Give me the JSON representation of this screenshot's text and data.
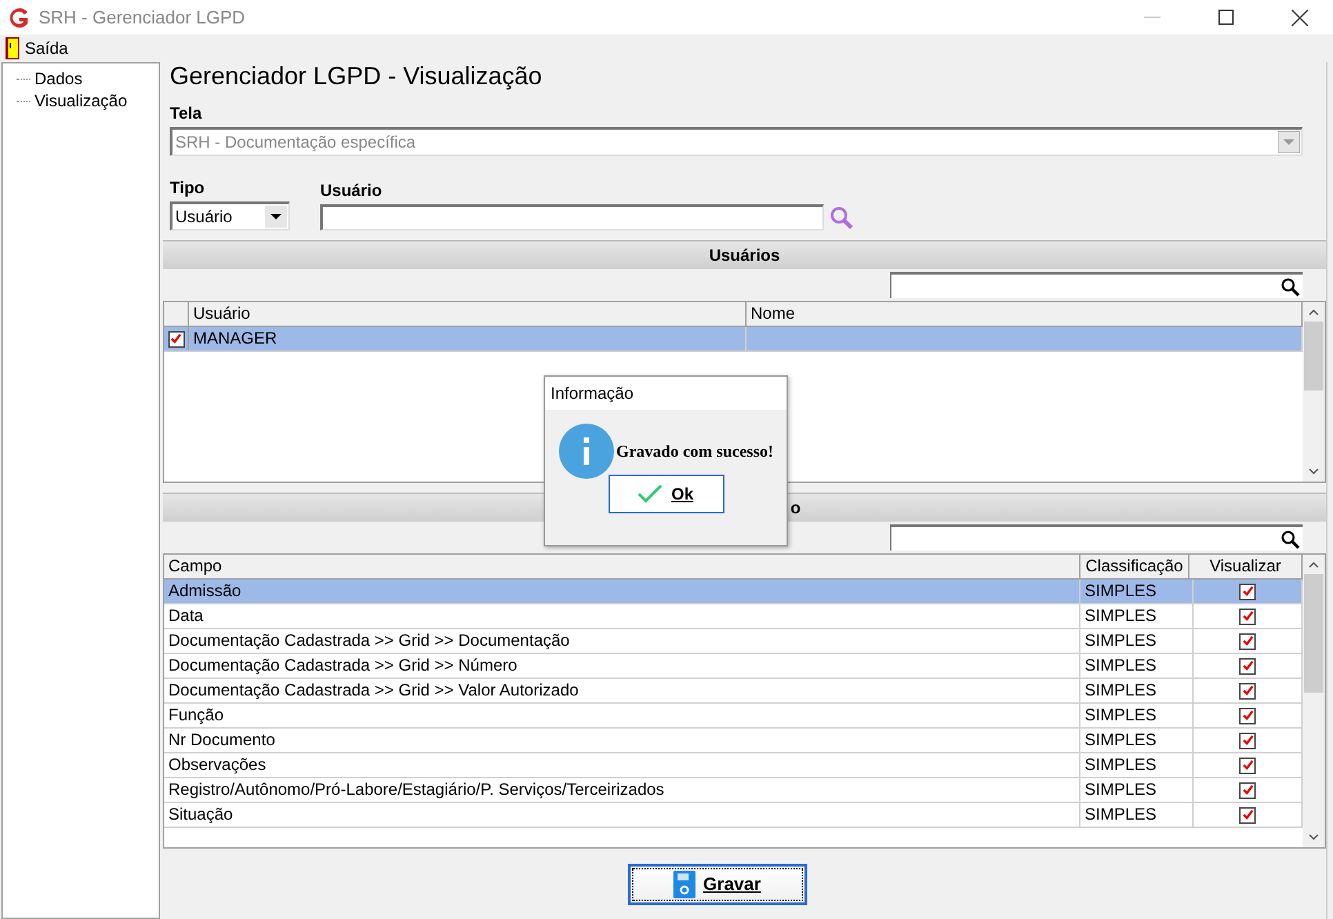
{
  "window": {
    "title": "SRH - Gerenciador LGPD"
  },
  "menu": [
    {
      "label": "Saída"
    }
  ],
  "sidebar": {
    "items": [
      {
        "label": "Dados"
      },
      {
        "label": "Visualização"
      }
    ]
  },
  "heading": "Gerenciador LGPD - Visualização",
  "tela": {
    "label": "Tela",
    "value": "SRH - Documentação específica",
    "disabled": true
  },
  "tipo": {
    "label": "Tipo",
    "value": "Usuário"
  },
  "usuario": {
    "label": "Usuário"
  },
  "users_section": {
    "title": "Usuários",
    "columns": [
      "Usuário",
      "Nome"
    ],
    "rows": [
      {
        "usuario": "MANAGER",
        "nome": "",
        "checked": true,
        "selected": true
      }
    ]
  },
  "fields_section": {
    "title": "o",
    "columns": [
      "Campo",
      "Classificação",
      "Visualizar"
    ],
    "rows": [
      {
        "campo": "Admissão",
        "classificacao": "SIMPLES",
        "checked": true,
        "selected": true
      },
      {
        "campo": "Data",
        "classificacao": "SIMPLES",
        "checked": true,
        "selected": false
      },
      {
        "campo": "Documentação Cadastrada >> Grid >> Documentação",
        "classificacao": "SIMPLES",
        "checked": true,
        "selected": false
      },
      {
        "campo": "Documentação Cadastrada >> Grid >> Número",
        "classificacao": "SIMPLES",
        "checked": true,
        "selected": false
      },
      {
        "campo": "Documentação Cadastrada >> Grid >> Valor Autorizado",
        "classificacao": "SIMPLES",
        "checked": true,
        "selected": false
      },
      {
        "campo": "Função",
        "classificacao": "SIMPLES",
        "checked": true,
        "selected": false
      },
      {
        "campo": "Nr Documento",
        "classificacao": "SIMPLES",
        "checked": true,
        "selected": false
      },
      {
        "campo": "Observações",
        "classificacao": "SIMPLES",
        "checked": true,
        "selected": false
      },
      {
        "campo": "Registro/Autônomo/Pró-Labore/Estagiário/P. Serviços/Terceirizados",
        "classificacao": "SIMPLES",
        "checked": true,
        "selected": false
      },
      {
        "campo": "Situação",
        "classificacao": "SIMPLES",
        "checked": true,
        "selected": false
      }
    ]
  },
  "save_button": {
    "label": "Gravar"
  },
  "dialog": {
    "title": "Informação",
    "message": "Gravado com sucesso!",
    "button": "Ok"
  }
}
